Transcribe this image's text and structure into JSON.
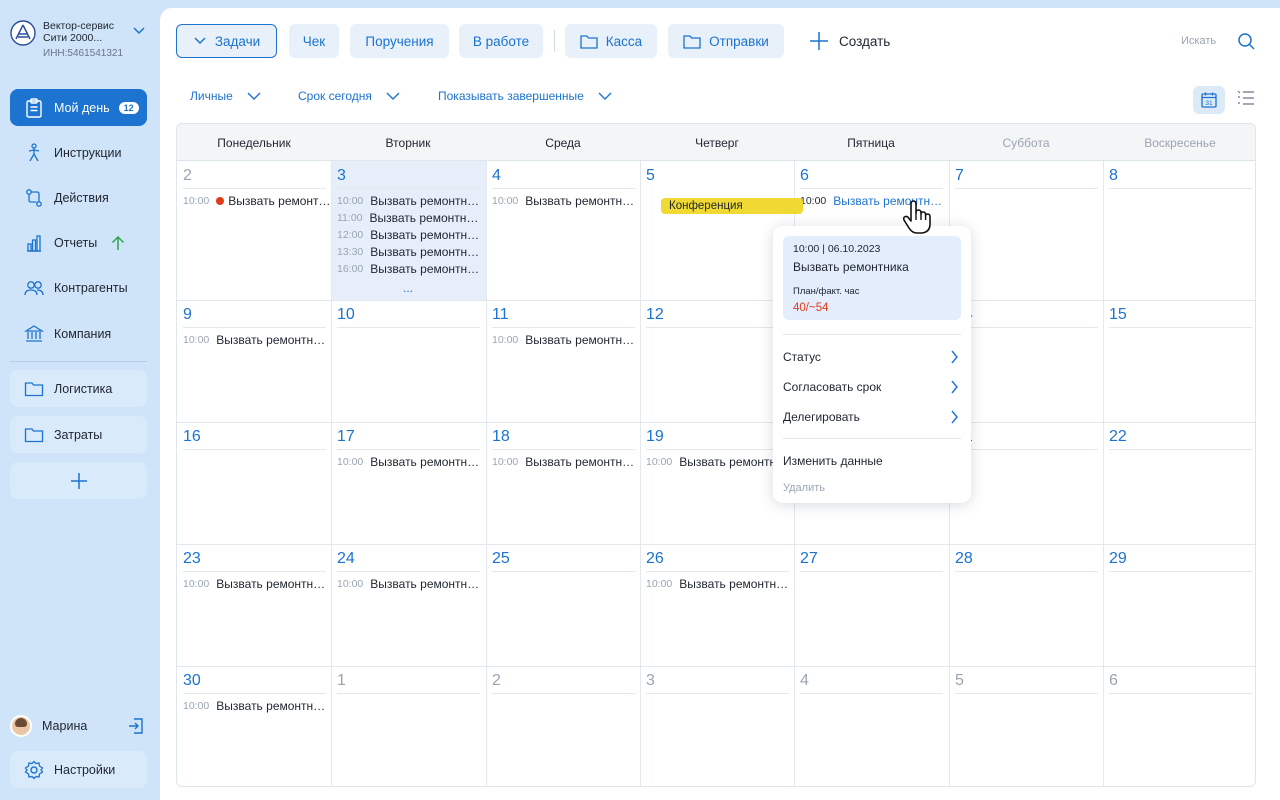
{
  "sidebar": {
    "org_name": "Вектор-сервис Сити 2000...",
    "org_inn": "ИНН:5461541321",
    "nav": [
      {
        "label": "Мой день",
        "badge": "12",
        "icon": "clipboard-icon",
        "active": true
      },
      {
        "label": "Инструкции",
        "icon": "person-run-icon"
      },
      {
        "label": "Действия",
        "icon": "flow-icon"
      },
      {
        "label": "Отчеты",
        "icon": "bar-chart-icon",
        "extra_icon": "arrow-up-icon"
      },
      {
        "label": "Контрагенты",
        "icon": "users-icon"
      },
      {
        "label": "Компания",
        "icon": "bank-icon"
      }
    ],
    "folders": [
      {
        "label": "Логистика",
        "icon": "folder-icon"
      },
      {
        "label": "Затраты",
        "icon": "folder-icon"
      }
    ],
    "add_icon": "plus-icon",
    "user_name": "Марина",
    "settings_label": "Настройки"
  },
  "toolbar": {
    "tasks_label": "Задачи",
    "check_label": "Чек",
    "orders_label": "Поручения",
    "inwork_label": "В работе",
    "kassa_label": "Касса",
    "shipments_label": "Отправки",
    "create_label": "Создать",
    "search_placeholder": "Искать"
  },
  "filters": {
    "personal": "Личные",
    "deadline": "Срок сегодня",
    "show_completed": "Показывать завершенные"
  },
  "calendar": {
    "weekdays": [
      "Понедельник",
      "Вторник",
      "Среда",
      "Четверг",
      "Пятница",
      "Суббота",
      "Воскресенье"
    ],
    "weeks": [
      [
        "2",
        "3",
        "4",
        "5",
        "6",
        "7",
        "8"
      ],
      [
        "9",
        "10",
        "11",
        "12",
        "13",
        "14",
        "15"
      ],
      [
        "16",
        "17",
        "18",
        "19",
        "20",
        "21",
        "22"
      ],
      [
        "23",
        "24",
        "25",
        "26",
        "27",
        "28",
        "29"
      ],
      [
        "30",
        "1",
        "2",
        "3",
        "4",
        "5",
        "6"
      ]
    ],
    "event_title": "Вызвать ремонтника",
    "events": [
      {
        "week": 0,
        "day": 0,
        "slot": 0,
        "time": "10:00",
        "dot": true
      },
      {
        "week": 0,
        "day": 1,
        "slot": 0,
        "time": "10:00"
      },
      {
        "week": 0,
        "day": 1,
        "slot": 1,
        "time": "11:00"
      },
      {
        "week": 0,
        "day": 1,
        "slot": 2,
        "time": "12:00"
      },
      {
        "week": 0,
        "day": 1,
        "slot": 3,
        "time": "13:30"
      },
      {
        "week": 0,
        "day": 1,
        "slot": 4,
        "time": "16:00"
      },
      {
        "week": 0,
        "day": 2,
        "slot": 0,
        "time": "10:00"
      },
      {
        "week": 0,
        "day": 4,
        "slot": 0,
        "time": "10:00",
        "highlight": true
      },
      {
        "week": 1,
        "day": 0,
        "slot": 0,
        "time": "10:00"
      },
      {
        "week": 1,
        "day": 2,
        "slot": 0,
        "time": "10:00"
      },
      {
        "week": 2,
        "day": 1,
        "slot": 0,
        "time": "10:00"
      },
      {
        "week": 2,
        "day": 2,
        "slot": 0,
        "time": "10:00"
      },
      {
        "week": 2,
        "day": 3,
        "slot": 0,
        "time": "10:00"
      },
      {
        "week": 3,
        "day": 0,
        "slot": 0,
        "time": "10:00"
      },
      {
        "week": 3,
        "day": 1,
        "slot": 0,
        "time": "10:00"
      },
      {
        "week": 3,
        "day": 3,
        "slot": 0,
        "time": "10:00"
      },
      {
        "week": 4,
        "day": 0,
        "slot": 0,
        "time": "10:00"
      }
    ],
    "more_label": "...",
    "conference_label": "Конференция",
    "colors": {
      "accent": "#1c73d0",
      "today_bg": "#e6eefa",
      "conference": "#f0d932",
      "overdue": "#e23b1c"
    }
  },
  "popup": {
    "datetime": "10:00 | 06.10.2023",
    "title": "Вызвать ремонтника",
    "plan_label": "План/факт. час",
    "plan_value": "40/~54",
    "actions": [
      "Статус",
      "Согласовать срок",
      "Делегировать"
    ],
    "edit_label": "Изменить данные",
    "delete_label": "Удалить"
  }
}
